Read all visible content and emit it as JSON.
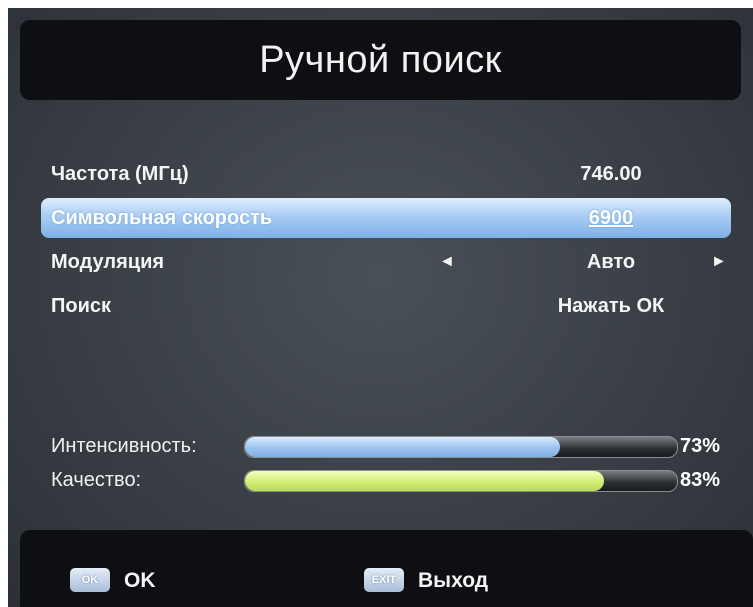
{
  "title": "Ручной поиск",
  "rows": [
    {
      "label": "Частота (МГц)",
      "value": "746.00"
    },
    {
      "label": "Символьная скорость",
      "value": "6900"
    },
    {
      "label": "Модуляция",
      "value": "Авто"
    },
    {
      "label": "Поиск",
      "value": "Нажать ОК"
    }
  ],
  "arrows": {
    "left": "◄",
    "right": "►"
  },
  "meters": [
    {
      "label": "Интенсивность:",
      "percent": 73,
      "percent_text": "73%",
      "color": "#9fc6ef"
    },
    {
      "label": "Качество:",
      "percent": 83,
      "percent_text": "83%",
      "color": "#d5f07a"
    }
  ],
  "footer": {
    "ok_key": "OK",
    "ok_label": "OK",
    "exit_key": "EXIT",
    "exit_label": "Выход"
  },
  "colors": {
    "highlight": "#a9cdf3",
    "background": "#3a3f46",
    "bar": "#0d0f12"
  }
}
